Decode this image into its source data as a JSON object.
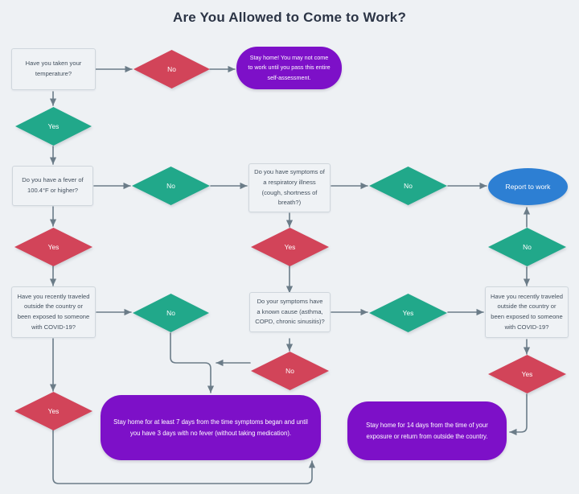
{
  "title": "Are You Allowed to Come to Work?",
  "colors": {
    "background": "#eef1f4",
    "title_text": "#2b3445",
    "question_box_fill": "#eff2f5",
    "question_box_border": "#cfd6dc",
    "yes_no_teal": "#21a88a",
    "yes_no_red": "#d24459",
    "stay_home_purple": "#7d10c8",
    "report_to_work_blue": "#2d7fd3",
    "connector_line": "#6b7c88"
  },
  "nodes": {
    "q_temperature": "Have you taken your temperature?",
    "d_temp_no": "No",
    "d_temp_yes": "Yes",
    "r_stay_home_assessment": "Stay home! You may not come to work until you pass this entire self-assessment.",
    "q_fever": "Do you have a fever of 100.4°F or higher?",
    "d_fever_no": "No",
    "d_fever_yes": "Yes",
    "q_respiratory": "Do you have symptoms of a respiratory illness (cough, shortness of breath?)",
    "d_resp_no": "No",
    "d_resp_yes": "Yes",
    "r_report_to_work": "Report to work",
    "q_travel_left": "Have you recently traveled outside the country or been exposed to someone with COVID-19?",
    "d_travel_left_no": "No",
    "d_travel_left_yes": "Yes",
    "q_known_cause": "Do your symptoms have a known cause (asthma, COPD, chronic sinusitis)?",
    "d_cause_yes": "Yes",
    "d_cause_no": "No",
    "q_travel_right": "Have you recently traveled outside the country or been exposed to someone with COVID-19?",
    "d_travel_right_no": "No",
    "d_travel_right_yes": "Yes",
    "r_stay_home_7days": "Stay home for at least 7 days from the time symptoms began and until you have 3 days with no fever (without taking medication).",
    "r_stay_home_14days": "Stay home for 14 days from the time of your exposure or return from outside the country."
  }
}
